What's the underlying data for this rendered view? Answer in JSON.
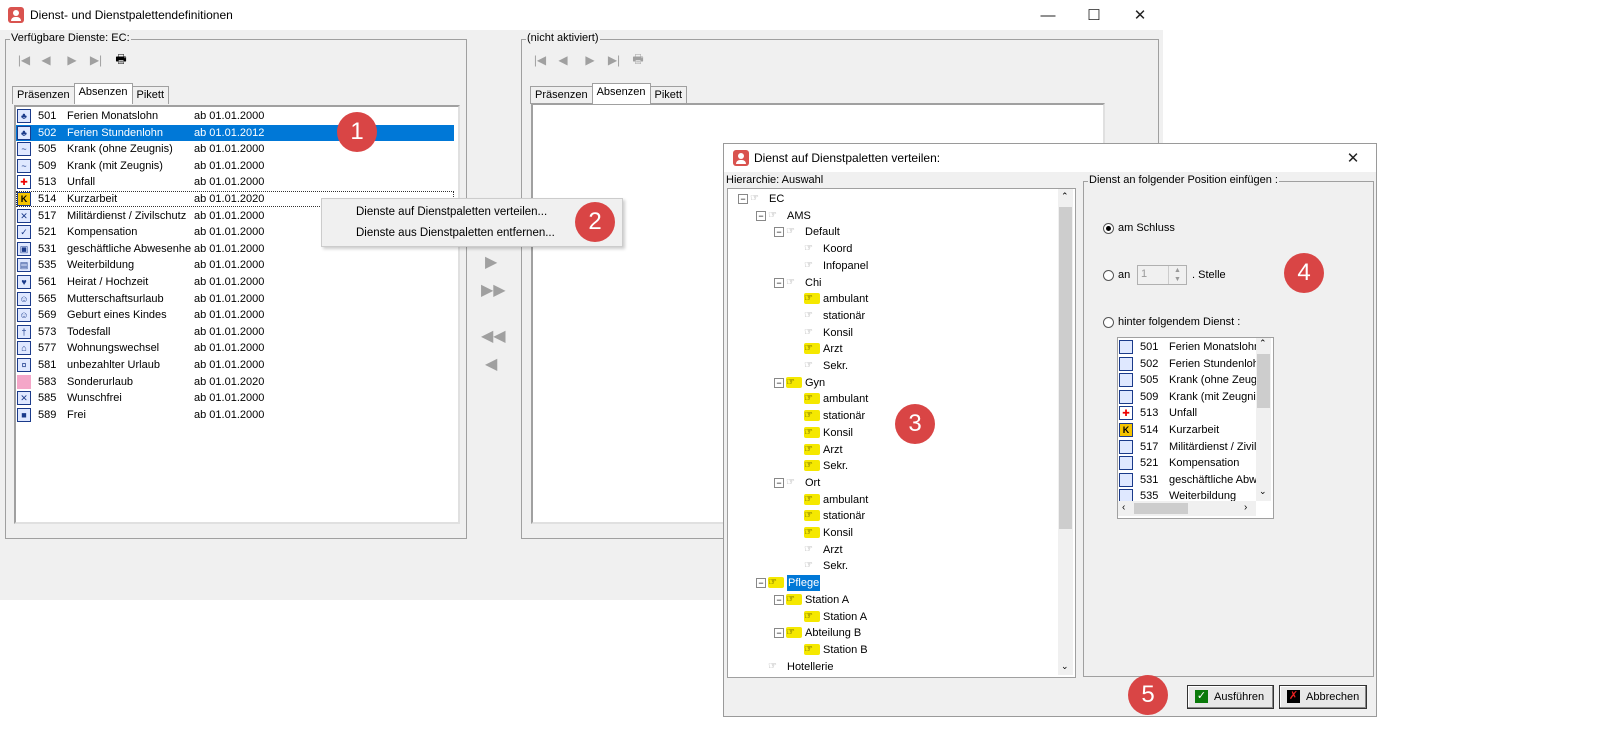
{
  "main_window": {
    "title": "Dienst- und Dienstpalettendefinitionen",
    "left_group_label": "Verfügbare Dienste: EC:",
    "right_group_label": "(nicht aktiviert)",
    "tabs": [
      "Präsenzen",
      "Absenzen",
      "Pikett"
    ],
    "active_tab": "Absenzen",
    "services": [
      {
        "code": "501",
        "name": "Ferien Monatslohn",
        "date": "ab 01.01.2000",
        "icon": "palm-icon"
      },
      {
        "code": "502",
        "name": "Ferien Stundenlohn",
        "date": "ab 01.01.2012",
        "icon": "palm-hour-icon"
      },
      {
        "code": "505",
        "name": "Krank (ohne Zeugnis)",
        "date": "ab 01.01.2000",
        "icon": "sick-icon"
      },
      {
        "code": "509",
        "name": "Krank (mit Zeugnis)",
        "date": "ab 01.01.2000",
        "icon": "sick-certificate-icon"
      },
      {
        "code": "513",
        "name": "Unfall",
        "date": "ab 01.01.2000",
        "icon": "red-cross-icon"
      },
      {
        "code": "514",
        "name": "Kurzarbeit",
        "date": "ab 01.01.2020",
        "icon": "k-icon"
      },
      {
        "code": "517",
        "name": "Militärdienst / Zivilschutz",
        "date": "ab 01.01.2000",
        "icon": "military-icon"
      },
      {
        "code": "521",
        "name": "Kompensation",
        "date": "ab 01.01.2000",
        "icon": "checkmark-icon"
      },
      {
        "code": "531",
        "name": "geschäftliche Abwesenheit",
        "date": "ab 01.01.2000",
        "icon": "business-icon"
      },
      {
        "code": "535",
        "name": "Weiterbildung",
        "date": "ab 01.01.2000",
        "icon": "training-icon"
      },
      {
        "code": "561",
        "name": "Heirat / Hochzeit",
        "date": "ab 01.01.2000",
        "icon": "heart-icon"
      },
      {
        "code": "565",
        "name": "Mutterschaftsurlaub",
        "date": "ab 01.01.2000",
        "icon": "baby-icon"
      },
      {
        "code": "569",
        "name": "Geburt eines Kindes",
        "date": "ab 01.01.2000",
        "icon": "birth-icon"
      },
      {
        "code": "573",
        "name": "Todesfall",
        "date": "ab 01.01.2000",
        "icon": "cross-icon"
      },
      {
        "code": "577",
        "name": "Wohnungswechsel",
        "date": "ab 01.01.2000",
        "icon": "house-icon"
      },
      {
        "code": "581",
        "name": "unbezahlter Urlaub",
        "date": "ab 01.01.2000",
        "icon": "unpaid-icon"
      },
      {
        "code": "583",
        "name": "Sonderurlaub",
        "date": "ab 01.01.2020",
        "icon": "pink-square-icon"
      },
      {
        "code": "585",
        "name": "Wunschfrei",
        "date": "ab 01.01.2000",
        "icon": "wish-icon"
      },
      {
        "code": "589",
        "name": "Frei",
        "date": "ab 01.01.2000",
        "icon": "free-icon"
      }
    ],
    "selected_code": "502",
    "focused_code": "514"
  },
  "context_menu": {
    "items": [
      "Dienste auf Dienstpaletten verteilen...",
      "Dienste aus Dienstpaletten entfernen..."
    ]
  },
  "dialog": {
    "title": "Dienst auf Dienstpaletten verteilen:",
    "hierarchy_label": "Hierarchie: Auswahl",
    "position_label": "Dienst an folgender Position einfügen :",
    "option_end": "am Schluss",
    "option_at": "an",
    "position_value": "1",
    "position_suffix": ". Stelle",
    "option_after": "hinter folgendem Dienst :",
    "after_list": [
      {
        "code": "501",
        "name": "Ferien Monatslohn"
      },
      {
        "code": "502",
        "name": "Ferien Stundenlohn"
      },
      {
        "code": "505",
        "name": "Krank (ohne Zeugnis)"
      },
      {
        "code": "509",
        "name": "Krank (mit Zeugnis)"
      },
      {
        "code": "513",
        "name": "Unfall"
      },
      {
        "code": "514",
        "name": "Kurzarbeit"
      },
      {
        "code": "517",
        "name": "Militärdienst / Zivilschutz"
      },
      {
        "code": "521",
        "name": "Kompensation"
      },
      {
        "code": "531",
        "name": "geschäftliche Abwesenheit"
      },
      {
        "code": "535",
        "name": "Weiterbildung"
      }
    ],
    "tree": [
      {
        "label": "EC",
        "depth": 0,
        "yellow": false
      },
      {
        "label": "AMS",
        "depth": 1,
        "yellow": false
      },
      {
        "label": "Default",
        "depth": 2,
        "yellow": false
      },
      {
        "label": "Koord",
        "depth": 3,
        "yellow": false
      },
      {
        "label": "Infopanel",
        "depth": 3,
        "yellow": false
      },
      {
        "label": "Chi",
        "depth": 2,
        "yellow": false
      },
      {
        "label": "ambulant",
        "depth": 3,
        "yellow": true
      },
      {
        "label": "stationär",
        "depth": 3,
        "yellow": false
      },
      {
        "label": "Konsil",
        "depth": 3,
        "yellow": false
      },
      {
        "label": "Arzt",
        "depth": 3,
        "yellow": true
      },
      {
        "label": "Sekr.",
        "depth": 3,
        "yellow": false
      },
      {
        "label": "Gyn",
        "depth": 2,
        "yellow": true
      },
      {
        "label": "ambulant",
        "depth": 3,
        "yellow": true
      },
      {
        "label": "stationär",
        "depth": 3,
        "yellow": true
      },
      {
        "label": "Konsil",
        "depth": 3,
        "yellow": true
      },
      {
        "label": "Arzt",
        "depth": 3,
        "yellow": true
      },
      {
        "label": "Sekr.",
        "depth": 3,
        "yellow": true
      },
      {
        "label": "Ort",
        "depth": 2,
        "yellow": false
      },
      {
        "label": "ambulant",
        "depth": 3,
        "yellow": true
      },
      {
        "label": "stationär",
        "depth": 3,
        "yellow": true
      },
      {
        "label": "Konsil",
        "depth": 3,
        "yellow": true
      },
      {
        "label": "Arzt",
        "depth": 3,
        "yellow": false
      },
      {
        "label": "Sekr.",
        "depth": 3,
        "yellow": false
      },
      {
        "label": "Pflege",
        "depth": 1,
        "yellow": true
      },
      {
        "label": "Station A",
        "depth": 2,
        "yellow": true
      },
      {
        "label": "Station A",
        "depth": 3,
        "yellow": true
      },
      {
        "label": "Abteilung B",
        "depth": 2,
        "yellow": true
      },
      {
        "label": "Station B",
        "depth": 3,
        "yellow": true
      },
      {
        "label": "Hotellerie",
        "depth": 1,
        "yellow": false
      }
    ],
    "tree_selected_index": 23,
    "execute_label": "Ausführen",
    "cancel_label": "Abbrechen"
  },
  "callouts": [
    "1",
    "2",
    "3",
    "4",
    "5"
  ],
  "colors": {
    "selection": "#0078d7",
    "callout": "#d94545",
    "hand_yellow": "#f5e800"
  }
}
